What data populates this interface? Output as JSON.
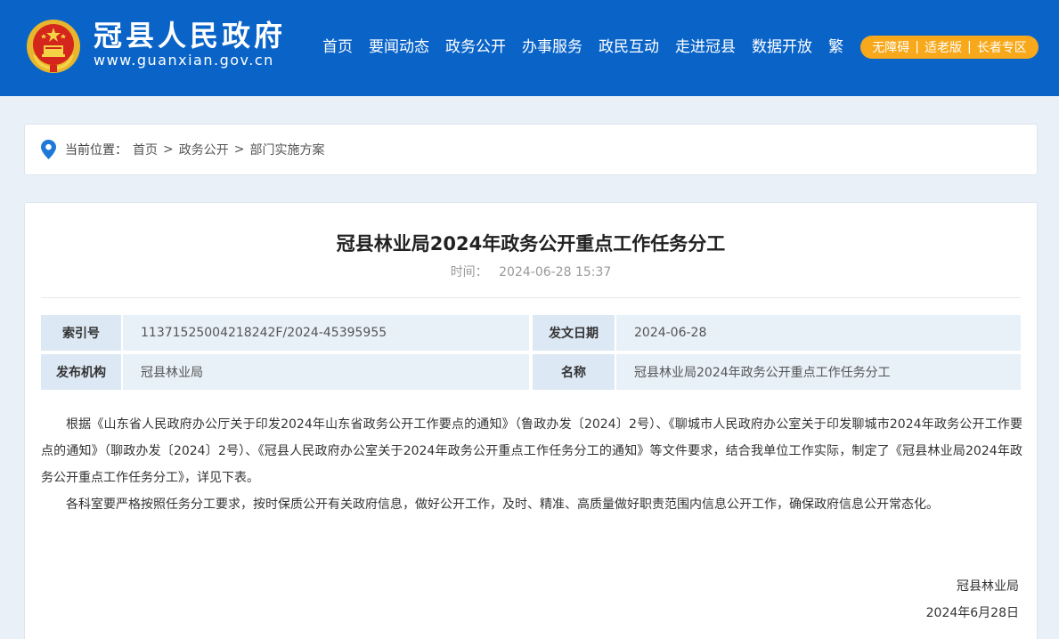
{
  "header": {
    "site_name": "冠县人民政府",
    "site_url": "www.guanxian.gov.cn",
    "brand_color": "#0a64c8",
    "nav": [
      "首页",
      "要闻动态",
      "政务公开",
      "办事服务",
      "政民互动",
      "走进冠县",
      "数据开放",
      "繁"
    ],
    "accessibility": {
      "items": [
        "无障碍",
        "适老版",
        "长者专区"
      ],
      "separator": "|",
      "color": "#f7a81b"
    }
  },
  "breadcrumb": {
    "prefix": "当前位置：",
    "items": [
      "首页",
      "政务公开",
      "部门实施方案"
    ],
    "separator": ">"
  },
  "article": {
    "title": "冠县林业局2024年政务公开重点工作任务分工",
    "time_label": "时间：",
    "time_value": "2024-06-28 15:37",
    "meta": {
      "index_label": "索引号",
      "index_value": "11371525004218242F/2024-45395955",
      "date_label": "发文日期",
      "date_value": "2024-06-28",
      "org_label": "发布机构",
      "org_value": "冠县林业局",
      "name_label": "名称",
      "name_value": "冠县林业局2024年政务公开重点工作任务分工"
    },
    "paragraphs": [
      "根据《山东省人民政府办公厅关于印发2024年山东省政务公开工作要点的通知》（鲁政办发〔2024〕2号）、《聊城市人民政府办公室关于印发聊城市2024年政务公开工作要点的通知》（聊政办发〔2024〕2号）、《冠县人民政府办公室关于2024年政务公开重点工作任务分工的通知》等文件要求，结合我单位工作实际，制定了《冠县林业局2024年政务公开重点工作任务分工》，详见下表。",
      "各科室要严格按照任务分工要求，按时保质公开有关政府信息，做好公开工作，及时、精准、高质量做好职责范围内信息公开工作，确保政府信息公开常态化。"
    ],
    "signature": {
      "org": "冠县林业局",
      "date": "2024年6月28日"
    }
  }
}
